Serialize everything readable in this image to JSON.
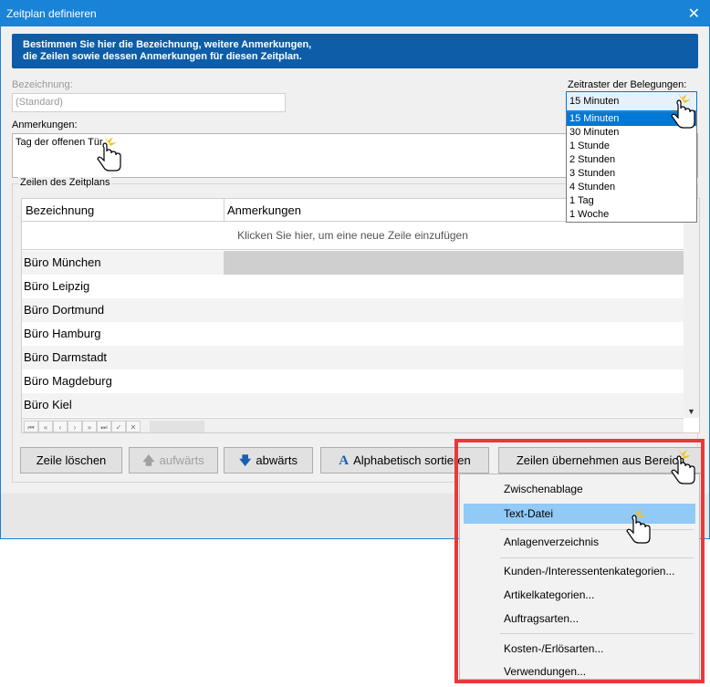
{
  "window": {
    "title": "Zeitplan definieren",
    "close_glyph": "✕"
  },
  "banner": {
    "line1": "Bestimmen Sie hier die Bezeichnung, weitere Anmerkungen,",
    "line2": "die Zeilen sowie dessen Anmerkungen für diesen Zeitplan."
  },
  "bezeichnung": {
    "label": "Bezeichnung:",
    "value": "(Standard)"
  },
  "zeitraster": {
    "label": "Zeitraster der Belegungen:",
    "value": "15 Minuten",
    "options": [
      "15 Minuten",
      "30 Minuten",
      "1 Stunde",
      "2 Stunden",
      "3 Stunden",
      "4 Stunden",
      "1 Tag",
      "1 Woche"
    ],
    "selected_index": 0
  },
  "anmerkungen": {
    "label": "Anmerkungen:",
    "value": "Tag der offenen Tür"
  },
  "zeilen": {
    "group_title": "Zeilen des Zeitplans",
    "columns": [
      "Bezeichnung",
      "Anmerkungen"
    ],
    "new_row_hint": "Klicken Sie hier, um eine neue Zeile einzufügen",
    "rows": [
      "Büro München",
      "Büro Leipzig",
      "Büro Dortmund",
      "Büro Hamburg",
      "Büro Darmstadt",
      "Büro Magdeburg",
      "Büro Kiel"
    ],
    "nav_buttons": [
      "⏮",
      "«",
      "‹",
      "›",
      "»",
      "⏭",
      "✓",
      "✕"
    ]
  },
  "buttons": {
    "delete": "Zeile löschen",
    "up": "aufwärts",
    "down": "abwärts",
    "sort": "Alphabetisch sortieren",
    "import": "Zeilen übernehmen aus Bereich"
  },
  "icons": {
    "up": "arrow-up-icon",
    "down": "arrow-down-icon",
    "sort": "letter-a-icon"
  },
  "import_menu": {
    "items": [
      "Zwischenablage",
      "Text-Datei",
      "Anlagenverzeichnis",
      "Kunden-/Interessentenkategorien...",
      "Artikelkategorien...",
      "Auftragsarten...",
      "Kosten-/Erlösarten...",
      "Verwendungen..."
    ],
    "hover_index": 1
  },
  "colors": {
    "accent": "#1883d7",
    "banner": "#0d5da8",
    "highlight_frame": "#e8393b",
    "menu_hover": "#91c9f7"
  }
}
